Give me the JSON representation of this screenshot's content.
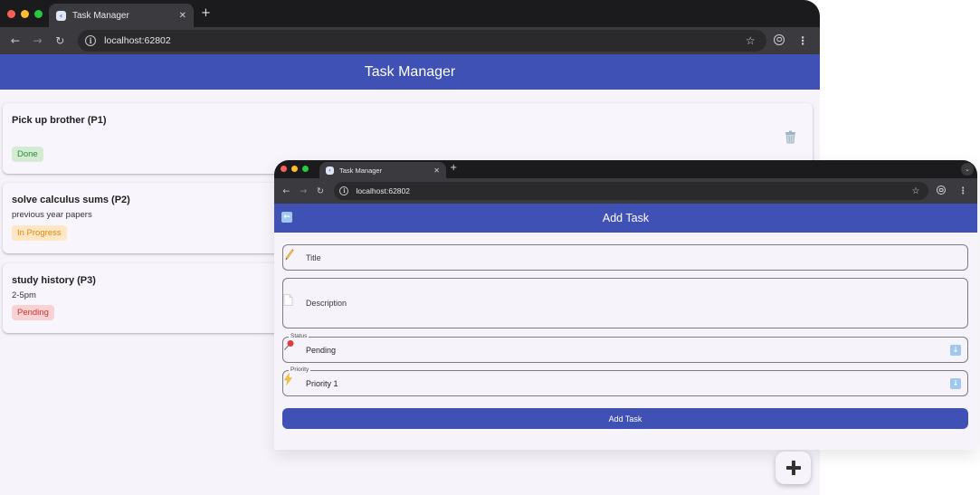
{
  "list_window": {
    "tab": {
      "title": "Task Manager"
    },
    "address": {
      "url": "localhost:62802"
    },
    "app_bar": {
      "title": "Task Manager"
    },
    "tasks": [
      {
        "title": "Pick up brother (P1)",
        "description": "",
        "status": "Done"
      },
      {
        "title": "solve calculus sums (P2)",
        "description": "previous year papers",
        "status": "In Progress"
      },
      {
        "title": "study history (P3)",
        "description": "2-5pm",
        "status": "Pending"
      }
    ]
  },
  "form_window": {
    "tab": {
      "title": "Task Manager"
    },
    "address": {
      "url": "localhost:62802"
    },
    "app_bar": {
      "title": "Add Task"
    },
    "fields": {
      "title": {
        "placeholder": "Title",
        "icon": "pencil-icon"
      },
      "description": {
        "placeholder": "Description",
        "icon": "page-icon"
      },
      "status": {
        "label": "Status",
        "value": "Pending",
        "icon": "pushpin-icon"
      },
      "priority": {
        "label": "Priority",
        "value": "Priority 1",
        "icon": "lightning-icon"
      }
    },
    "submit_label": "Add Task"
  },
  "colors": {
    "primary": "#3f51b5",
    "done_text": "#2e8a33",
    "in_progress_text": "#e7870b",
    "pending_text": "#d23030"
  }
}
